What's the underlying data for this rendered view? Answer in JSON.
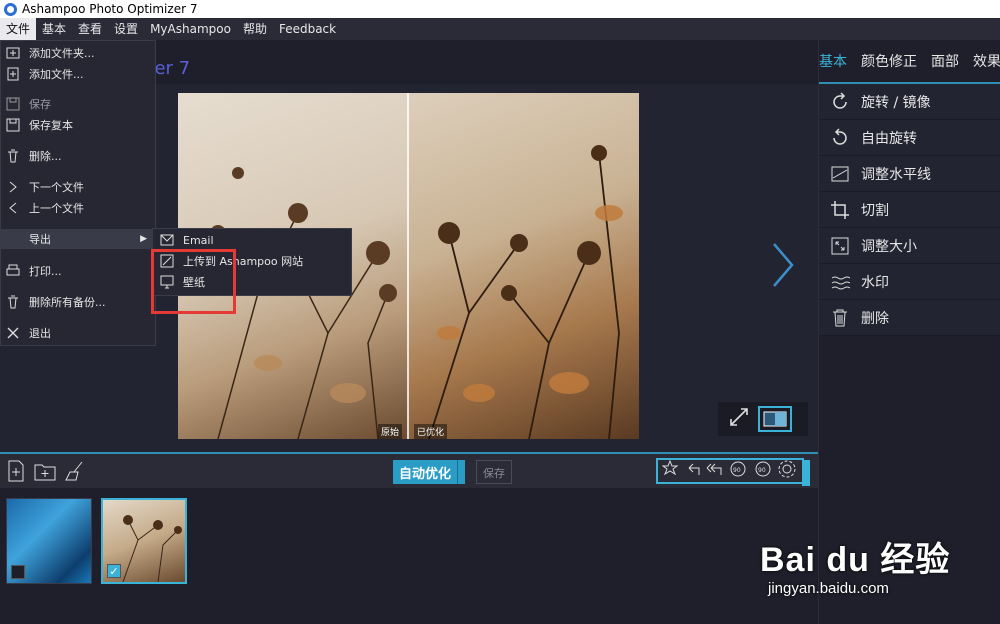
{
  "window": {
    "title": "Ashampoo Photo Optimizer 7"
  },
  "menubar": [
    {
      "label": "文件",
      "active": true
    },
    {
      "label": "基本"
    },
    {
      "label": "查看"
    },
    {
      "label": "设置"
    },
    {
      "label": "MyAshampoo"
    },
    {
      "label": "帮助"
    },
    {
      "label": "Feedback"
    }
  ],
  "app_title_partial": "izer 7",
  "file_menu": [
    {
      "label": "添加文件夹...",
      "icon": "add-folder-icon"
    },
    {
      "label": "添加文件...",
      "icon": "add-file-icon"
    },
    {
      "label": "保存",
      "icon": "save-icon",
      "disabled": true
    },
    {
      "label": "保存复本",
      "icon": "save-copy-icon"
    },
    {
      "label": "删除...",
      "icon": "trash-icon"
    },
    {
      "label": "下一个文件",
      "icon": "chevron-right-icon"
    },
    {
      "label": "上一个文件",
      "icon": "chevron-left-icon"
    },
    {
      "label": "导出",
      "icon": "",
      "highlighted": true,
      "has_submenu": true
    },
    {
      "label": "打印...",
      "icon": "printer-icon"
    },
    {
      "label": "删除所有备份...",
      "icon": "trash-icon"
    },
    {
      "label": "退出",
      "icon": "close-icon"
    }
  ],
  "export_submenu": [
    {
      "label": "Email",
      "icon": "mail-icon"
    },
    {
      "label": "上传到 Ashampoo 网站",
      "icon": "upload-icon"
    },
    {
      "label": "壁纸",
      "icon": "monitor-icon"
    }
  ],
  "preview": {
    "label_original": "原始",
    "label_optimized": "已优化"
  },
  "right_panel": {
    "tabs": [
      "基本",
      "颜色修正",
      "面部",
      "效果"
    ],
    "active_tab": "基本",
    "items": [
      {
        "label": "旋转 / 镜像",
        "icon": "rotate-icon"
      },
      {
        "label": "自由旋转",
        "icon": "free-rotate-icon"
      },
      {
        "label": "调整水平线",
        "icon": "horizon-icon"
      },
      {
        "label": "切割",
        "icon": "crop-icon"
      },
      {
        "label": "调整大小",
        "icon": "resize-icon"
      },
      {
        "label": "水印",
        "icon": "watermark-icon"
      },
      {
        "label": "删除",
        "icon": "trash-icon"
      }
    ]
  },
  "bottom_bar": {
    "auto_optimize_label": "自动优化",
    "save_label": "保存"
  },
  "thumbnails": [
    {
      "name": "blue-texture",
      "checked": false
    },
    {
      "name": "dried-flowers",
      "checked": true,
      "selected": true
    }
  ],
  "watermark": {
    "brand": "Bai du 经验",
    "url": "jingyan.baidu.com"
  },
  "colors": {
    "accent": "#3bb3d8",
    "highlight_box": "#e53935",
    "title": "#5b5fd6"
  }
}
